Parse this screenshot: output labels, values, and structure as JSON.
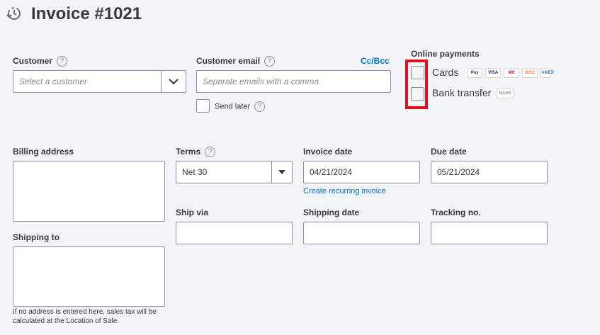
{
  "header": {
    "title": "Invoice #1021"
  },
  "customer": {
    "label": "Customer",
    "placeholder": "Select a customer"
  },
  "email": {
    "label": "Customer email",
    "placeholder": "Separate emails with a comma",
    "cc_bcc": "Cc/Bcc",
    "send_later": "Send later"
  },
  "online_payments": {
    "title": "Online payments",
    "cards": "Cards",
    "bank_transfer": "Bank transfer",
    "card_icons": [
      "Pay",
      "VISA",
      "MC",
      "DISC",
      "AMEX"
    ],
    "bank_icon": "BANK"
  },
  "billing": {
    "label": "Billing address"
  },
  "shipping_to": {
    "label": "Shipping to",
    "note": "If no address is entered here, sales tax will be calculated at the Location of Sale."
  },
  "terms": {
    "label": "Terms",
    "value": "Net 30"
  },
  "invoice_date": {
    "label": "Invoice date",
    "value": "04/21/2024",
    "recurring": "Create recurring invoice"
  },
  "due_date": {
    "label": "Due date",
    "value": "05/21/2024"
  },
  "ship_via": {
    "label": "Ship via"
  },
  "shipping_date": {
    "label": "Shipping date"
  },
  "tracking": {
    "label": "Tracking no."
  }
}
